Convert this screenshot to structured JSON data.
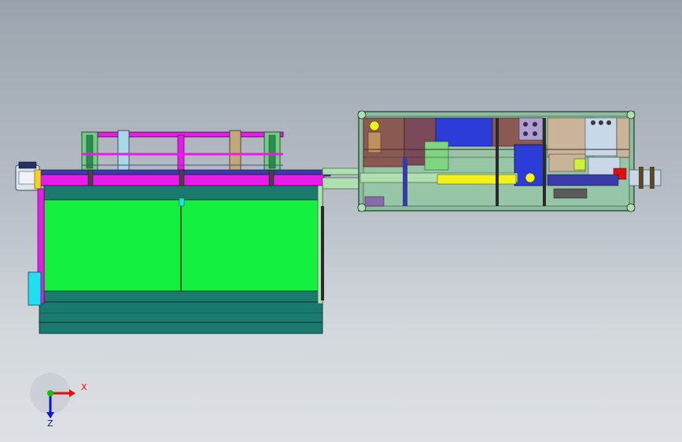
{
  "viewport": {
    "background_top": "#9aa3ad",
    "background_bottom": "#dde1e5"
  },
  "triad": {
    "x_label": "X",
    "z_label": "Z",
    "x_color": "#e01010",
    "y_color": "#10c010",
    "z_color": "#1010d0"
  },
  "colors": {
    "tank_green": "#14f040",
    "tank_teal": "#1a7a6e",
    "rail_magenta": "#e81ce8",
    "frame_green": "#7fd47f",
    "motor_blue": "#2c3cd8",
    "panel_brown": "#8a5a52",
    "shaft_yellow": "#f2f21a",
    "cyan_box": "#20e0f0"
  }
}
